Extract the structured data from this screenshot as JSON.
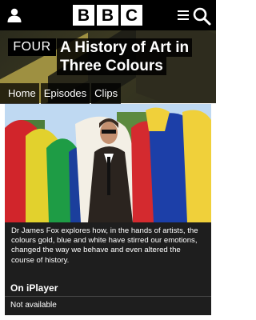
{
  "header": {
    "logo_letters": [
      "B",
      "B",
      "C"
    ],
    "icons": [
      "user-icon",
      "menu-icon",
      "search-icon"
    ]
  },
  "programme": {
    "channel": "FOUR",
    "title_line1": "A History of Art in",
    "title_line2": "Three Colours"
  },
  "nav": {
    "tabs": [
      "Home",
      "Episodes",
      "Clips"
    ]
  },
  "description": "Dr James Fox explores how, in the hands of artists, the colours gold, blue and white have stirred our emotions, changed the way we behave and even altered the course of history.",
  "iplayer": {
    "heading": "On iPlayer",
    "status": "Not available"
  },
  "colors": {
    "background": "#000000",
    "panel": "#1e1e1e",
    "text": "#ffffff"
  }
}
